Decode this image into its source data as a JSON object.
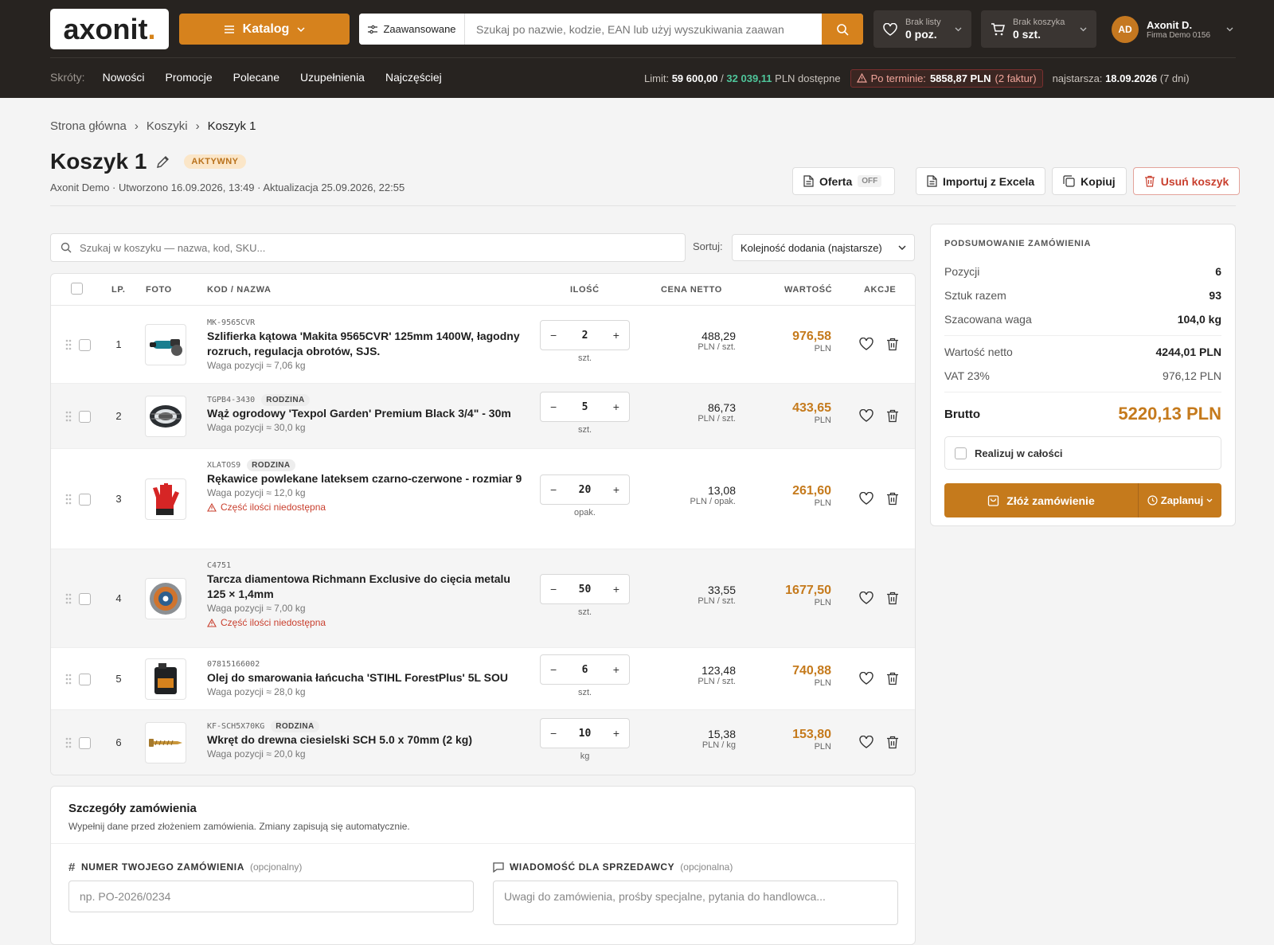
{
  "header": {
    "logo": "axonit",
    "katalog": "Katalog",
    "advanced": "Zaawansowane",
    "search_placeholder": "Szukaj po nazwie, kodzie, EAN lub użyj wyszukiwania zaawan",
    "wishlist_small": "Brak listy",
    "wishlist_big": "0 poz.",
    "cart_small": "Brak koszyka",
    "cart_big": "0 szt.",
    "user_initials": "AD",
    "user_name": "Axonit D.",
    "user_company": "Firma Demo 0156"
  },
  "shortcuts": {
    "label": "Skróty:",
    "items": [
      "Nowości",
      "Promocje",
      "Polecane",
      "Uzupełnienia",
      "Najczęściej"
    ]
  },
  "limits": {
    "limit_label": "Limit:",
    "limit_value": "59 600,00",
    "slash": "/",
    "available_value": "32 039,11",
    "available_suffix": "PLN dostępne",
    "overdue_label": "Po terminie:",
    "overdue_value": "5858,87 PLN",
    "overdue_count": "(2 faktur)",
    "oldest_label": "najstarsza:",
    "oldest_date": "18.09.2026",
    "oldest_days": "(7 dni)"
  },
  "breadcrumb": [
    "Strona główna",
    "Koszyki",
    "Koszyk 1"
  ],
  "page": {
    "title": "Koszyk 1",
    "status": "AKTYWNY",
    "meta": "Axonit Demo · Utworzono 16.09.2026, 13:49 · Aktualizacja 25.09.2026, 22:55"
  },
  "actions": {
    "offer": "Oferta",
    "offer_state": "OFF",
    "import": "Importuj z Excela",
    "copy": "Kopiuj",
    "delete": "Usuń koszyk"
  },
  "cart_search_placeholder": "Szukaj w koszyku — nazwa, kod, SKU...",
  "sort": {
    "label": "Sortuj:",
    "value": "Kolejność dodania (najstarsze)"
  },
  "table_headers": {
    "lp": "LP.",
    "foto": "FOTO",
    "name": "KOD / NAZWA",
    "qty": "ILOŚĆ",
    "price": "CENA NETTO",
    "value": "WARTOŚĆ",
    "actions": "AKCJE"
  },
  "items": [
    {
      "lp": "1",
      "code": "MK-9565CVR",
      "family": "",
      "name": "Szlifierka kątowa 'Makita 9565CVR' 125mm 1400W, łagodny rozruch, regulacja obrotów, SJS.",
      "weight": "Waga pozycji ≈ 7,06 kg",
      "warning": "",
      "qty": "2",
      "unit": "szt.",
      "price": "488,29",
      "price_unit": "PLN / szt.",
      "value": "976,58",
      "currency": "PLN",
      "icon": "angle-grinder-icon"
    },
    {
      "lp": "2",
      "code": "TGPB4-3430",
      "family": "RODZINA",
      "name": "Wąż ogrodowy 'Texpol Garden' Premium Black 3/4\" - 30m",
      "weight": "Waga pozycji ≈ 30,0 kg",
      "warning": "",
      "qty": "5",
      "unit": "szt.",
      "price": "86,73",
      "price_unit": "PLN / szt.",
      "value": "433,65",
      "currency": "PLN",
      "icon": "garden-hose-icon"
    },
    {
      "lp": "3",
      "code": "XLATOS9",
      "family": "RODZINA",
      "name": "Rękawice powlekane lateksem czarno-czerwone - rozmiar 9",
      "weight": "Waga pozycji ≈ 12,0 kg",
      "warning": "Część ilości niedostępna",
      "qty": "20",
      "unit": "opak.",
      "price": "13,08",
      "price_unit": "PLN / opak.",
      "value": "261,60",
      "currency": "PLN",
      "icon": "gloves-icon"
    },
    {
      "lp": "4",
      "code": "C4751",
      "family": "",
      "name": "Tarcza diamentowa Richmann Exclusive do cięcia metalu 125 × 1,4mm",
      "weight": "Waga pozycji ≈ 7,00 kg",
      "warning": "Część ilości niedostępna",
      "qty": "50",
      "unit": "szt.",
      "price": "33,55",
      "price_unit": "PLN / szt.",
      "value": "1677,50",
      "currency": "PLN",
      "icon": "cutting-disc-icon"
    },
    {
      "lp": "5",
      "code": "07815166002",
      "family": "",
      "name": "Olej do smarowania łańcucha 'STIHL ForestPlus' 5L SOU",
      "weight": "Waga pozycji ≈ 28,0 kg",
      "warning": "",
      "qty": "6",
      "unit": "szt.",
      "price": "123,48",
      "price_unit": "PLN / szt.",
      "value": "740,88",
      "currency": "PLN",
      "icon": "oil-canister-icon"
    },
    {
      "lp": "6",
      "code": "KF-SCH5X70KG",
      "family": "RODZINA",
      "name": "Wkręt do drewna ciesielski SCH 5.0 x 70mm (2 kg)",
      "weight": "Waga pozycji ≈ 20,0 kg",
      "warning": "",
      "qty": "10",
      "unit": "kg",
      "price": "15,38",
      "price_unit": "PLN / kg",
      "value": "153,80",
      "currency": "PLN",
      "icon": "screw-icon"
    }
  ],
  "summary": {
    "title": "PODSUMOWANIE ZAMÓWIENIA",
    "positions_label": "Pozycji",
    "positions": "6",
    "pieces_label": "Sztuk razem",
    "pieces": "93",
    "weight_label": "Szacowana waga",
    "weight": "104,0 kg",
    "net_label": "Wartość netto",
    "net": "4244,01 PLN",
    "vat_label": "VAT 23%",
    "vat": "976,12 PLN",
    "gross_label": "Brutto",
    "gross": "5220,13 PLN",
    "full_label": "Realizuj w całości",
    "order_button": "Złóż zamówienie",
    "plan_button": "Zaplanuj"
  },
  "details": {
    "title": "Szczegóły zamówienia",
    "subtitle": "Wypełnij dane przed złożeniem zamówienia. Zmiany zapisują się automatycznie.",
    "po_label": "NUMER TWOJEGO ZAMÓWIENIA",
    "po_optional": "(opcjonalny)",
    "po_placeholder": "np. PO-2026/0234",
    "msg_label": "WIADOMOŚĆ DLA SPRZEDAWCY",
    "msg_optional": "(opcjonalna)",
    "msg_placeholder": "Uwagi do zamówienia, prośby specjalne, pytania do handlowca..."
  },
  "colors": {
    "accent": "#d6821d",
    "header_bg": "#272320",
    "value": "#c57a1c",
    "danger": "#c9402f"
  }
}
